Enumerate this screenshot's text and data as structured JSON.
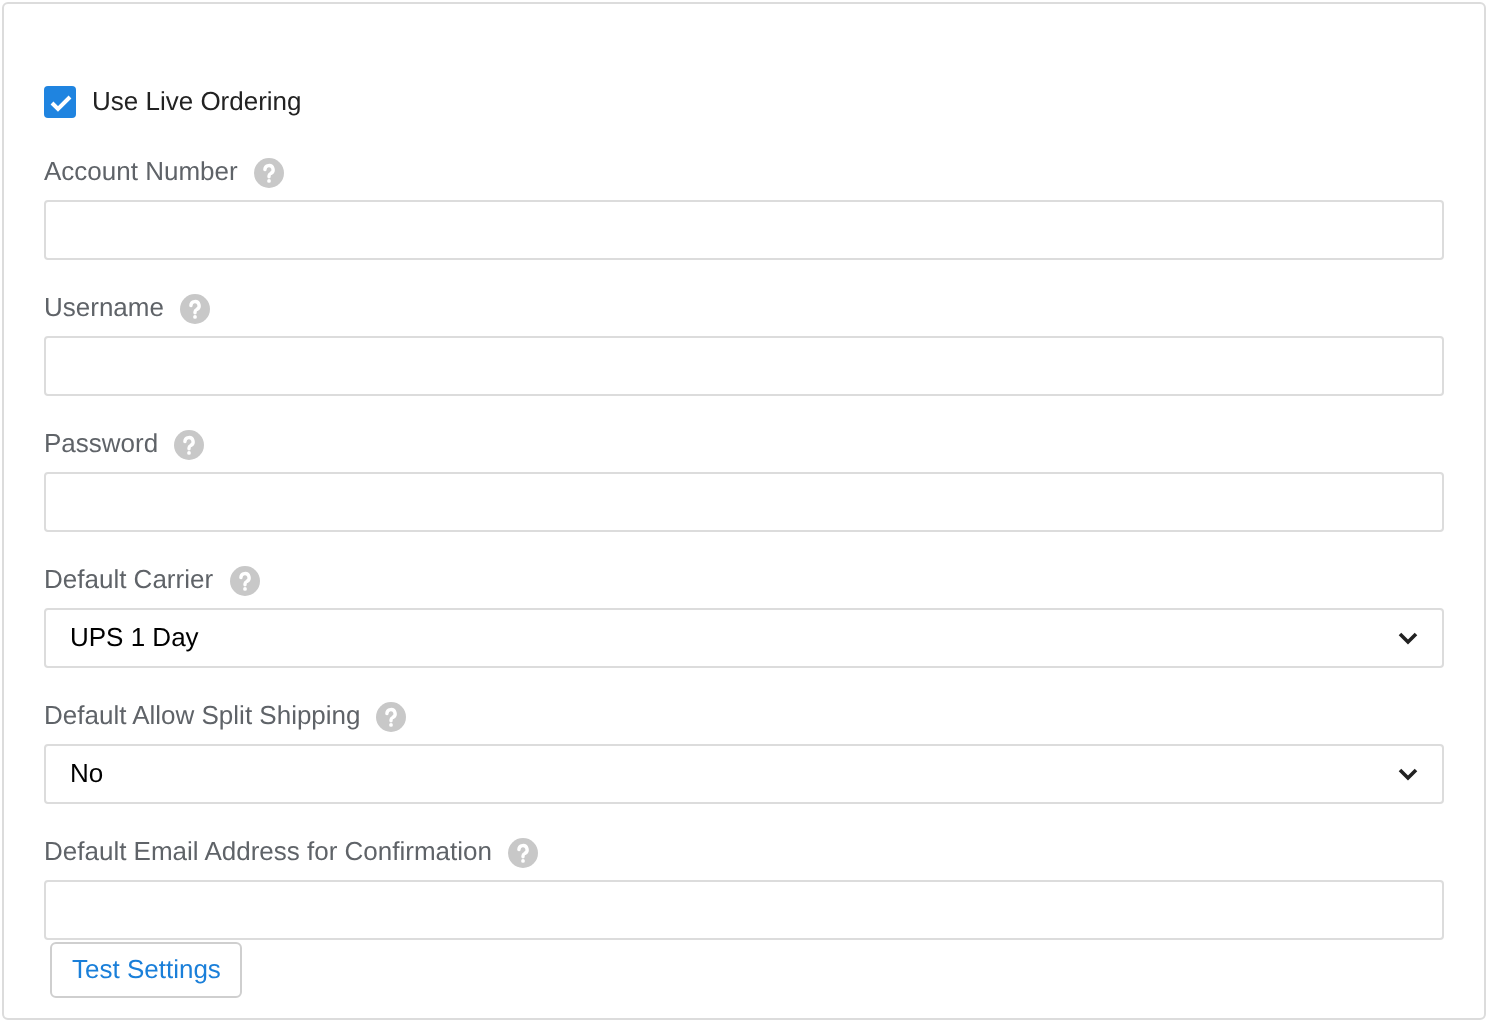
{
  "live_ordering": {
    "label": "Use Live Ordering",
    "checked": true
  },
  "fields": [
    {
      "kind": "text",
      "label": "Account Number"
    },
    {
      "kind": "text",
      "label": "Username"
    },
    {
      "kind": "text",
      "label": "Password"
    },
    {
      "kind": "select",
      "label": "Default Carrier",
      "value": "UPS 1 Day"
    },
    {
      "kind": "select",
      "label": "Default Allow Split Shipping",
      "value": "No"
    },
    {
      "kind": "text",
      "label": "Default Email Address for Confirmation"
    }
  ],
  "test_button": "Test Settings"
}
